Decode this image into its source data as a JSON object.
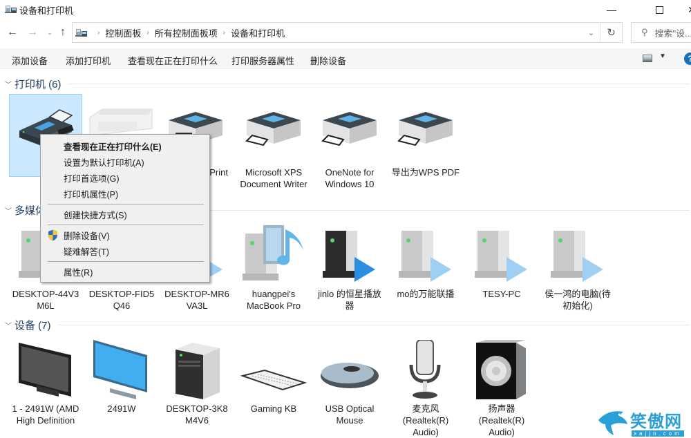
{
  "window": {
    "title": "设备和打印机",
    "minimize_icon": "minimize-icon",
    "maximize_icon": "maximize-icon",
    "close_icon": "close-icon"
  },
  "nav": {
    "back_icon": "back-arrow-icon",
    "forward_icon": "forward-arrow-icon",
    "recent_icon": "chevron-down-icon",
    "up_icon": "up-arrow-icon",
    "breadcrumb": [
      "控制面板",
      "所有控制面板项",
      "设备和打印机"
    ],
    "refresh_icon": "refresh-icon",
    "search_placeholder": "搜索\"设..."
  },
  "toolbar": {
    "commands": [
      "添加设备",
      "添加打印机",
      "查看现在正在打印什么",
      "打印服务器属性",
      "删除设备"
    ],
    "help_label": "?"
  },
  "groups": {
    "printers": {
      "title": "打印机 (6)",
      "items": [
        {
          "label": "",
          "icon": "fax-icon",
          "selected": true
        },
        {
          "label": "",
          "icon": "inkjet-printer-icon"
        },
        {
          "label": "Print",
          "icon": "printer-icon"
        },
        {
          "label": "Microsoft XPS Document Writer",
          "icon": "printer-icon"
        },
        {
          "label": "OneNote for Windows 10",
          "icon": "printer-icon"
        },
        {
          "label": "导出为WPS PDF",
          "icon": "printer-icon"
        }
      ]
    },
    "media": {
      "title": "多媒体",
      "items": [
        {
          "label": "DESKTOP-44V3 M6L",
          "icon": "media-server-icon"
        },
        {
          "label": "DESKTOP-FID5 Q46",
          "icon": "media-server-icon"
        },
        {
          "label": "DESKTOP-MR6 VA3L",
          "icon": "media-server-icon"
        },
        {
          "label": "huangpei's MacBook Pro",
          "icon": "media-library-icon"
        },
        {
          "label": "jinlo 的恒星播放器",
          "icon": "media-player-dark-icon"
        },
        {
          "label": "mo的万能联播",
          "icon": "media-server-icon"
        },
        {
          "label": "TESY-PC",
          "icon": "media-server-icon"
        },
        {
          "label": "侯一鸿的电脑(待初始化)",
          "icon": "media-server-icon"
        }
      ]
    },
    "devices": {
      "title": "设备 (7)",
      "items": [
        {
          "label": "1 - 2491W (AMD High Definition",
          "icon": "monitor-dark-icon"
        },
        {
          "label": "2491W",
          "icon": "monitor-blue-icon"
        },
        {
          "label": "DESKTOP-3K8 M4V6",
          "icon": "computer-tower-icon"
        },
        {
          "label": "Gaming KB",
          "icon": "keyboard-icon"
        },
        {
          "label": "USB Optical Mouse",
          "icon": "mouse-icon"
        },
        {
          "label": "麦克风 (Realtek(R) Audio)",
          "icon": "microphone-icon"
        },
        {
          "label": "扬声器 (Realtek(R) Audio)",
          "icon": "speaker-icon"
        }
      ]
    }
  },
  "context_menu": {
    "items": [
      {
        "label": "查看现在正在打印什么(E)",
        "default": true
      },
      {
        "label": "设置为默认打印机(A)"
      },
      {
        "label": "打印首选项(G)"
      },
      {
        "label": "打印机属性(P)"
      },
      {
        "label": "创建快捷方式(S)"
      },
      {
        "label": "删除设备(V)",
        "icon": "shield-icon"
      },
      {
        "label": "疑难解答(T)"
      },
      {
        "label": "属性(R)"
      }
    ]
  },
  "watermark": {
    "text": "笑傲网",
    "url": "xajjn.com"
  }
}
